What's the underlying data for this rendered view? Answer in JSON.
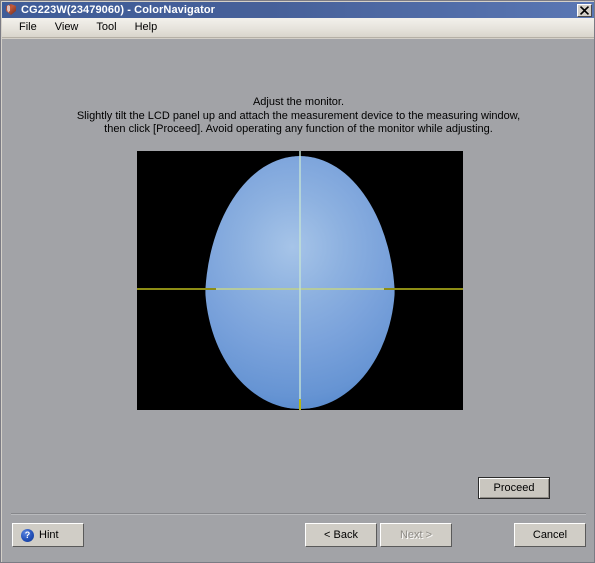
{
  "window": {
    "title": "CG223W(23479060) - ColorNavigator",
    "icon": "eizo-shield-icon",
    "close_label": "✕"
  },
  "menubar": {
    "items": [
      {
        "label": "File"
      },
      {
        "label": "View"
      },
      {
        "label": "Tool"
      },
      {
        "label": "Help"
      }
    ]
  },
  "instructions": {
    "line1": "Adjust the monitor.",
    "line2": "Slightly tilt the LCD panel up and attach the measurement device to the measuring window,",
    "line3": "then click [Proceed].  Avoid operating any function of the monitor while adjusting."
  },
  "measurement": {
    "panel_background": "#000000",
    "blob_color_light": "#a6c4e8",
    "blob_color_dark": "#1f5fb4",
    "crosshair_color": "#8d8d15",
    "crosshair_inner_color": "#c4e2d4"
  },
  "buttons": {
    "proceed": "Proceed",
    "hint": "Hint",
    "hint_icon": "question-mark-icon",
    "back": "< Back",
    "next": "Next >",
    "cancel": "Cancel"
  },
  "colors": {
    "titlebar_start": "#3f5c98",
    "titlebar_end": "#5a77b4",
    "client_background": "#a2a3a7",
    "button_face": "#d0cdc6"
  }
}
